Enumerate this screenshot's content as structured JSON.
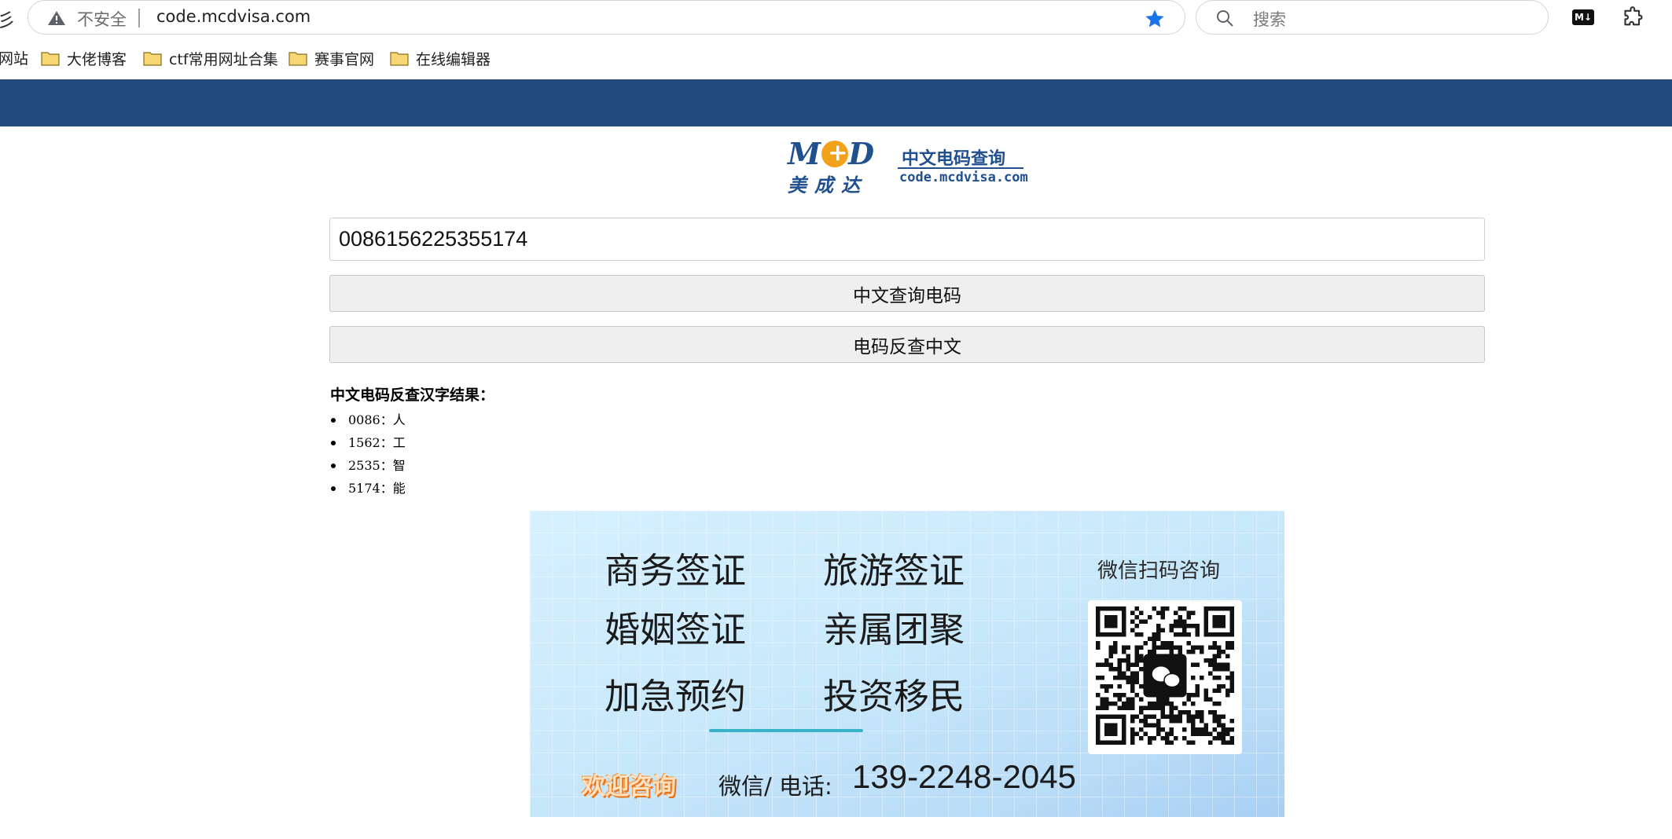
{
  "browser": {
    "left_edge_glyph": "彡",
    "insecure_label": "不安全",
    "url": "code.mcdvisa.com",
    "search_placeholder": "搜索",
    "md_icon_text": "M↓",
    "bookmarks": {
      "partial_label": "网站",
      "items": [
        {
          "label": "大佬博客"
        },
        {
          "label": "ctf常用网址合集"
        },
        {
          "label": "赛事官网"
        },
        {
          "label": "在线编辑器"
        }
      ]
    }
  },
  "logo": {
    "mark": "MCD",
    "mark_prefix": "M",
    "mark_suffix": "D",
    "chinese_name": "美成达",
    "title": "中文电码查询",
    "domain": "code.mcdvisa.com"
  },
  "form": {
    "input_value": "0086156225355174",
    "query_button": "中文查询电码",
    "reverse_button": "电码反查中文"
  },
  "result": {
    "title": "中文电码反查汉字结果：",
    "items": [
      {
        "text": "0086：人"
      },
      {
        "text": "1562：工"
      },
      {
        "text": "2535：智"
      },
      {
        "text": "5174：能"
      }
    ]
  },
  "banner": {
    "services": [
      "商务签证",
      "旅游签证",
      "婚姻签证",
      "亲属团聚",
      "加急预约",
      "投资移民"
    ],
    "qr_label": "微信扫码咨询",
    "welcome": "欢迎咨询",
    "contact_label": "微信/ 电话:",
    "phone": "139-2248-2045"
  },
  "colors": {
    "header_blue": "#234a7d",
    "logo_blue": "#21508f",
    "logo_orange": "#f2a11a",
    "star_blue": "#1a73e8",
    "banner_accent": "#37b2c8"
  },
  "icons": {
    "warning": "warning-triangle-icon",
    "star": "star-icon",
    "search": "search-icon",
    "markdown": "markdown-icon",
    "extensions": "puzzle-icon",
    "folder": "folder-icon",
    "wechat": "wechat-icon",
    "qr": "qr-code-icon"
  }
}
